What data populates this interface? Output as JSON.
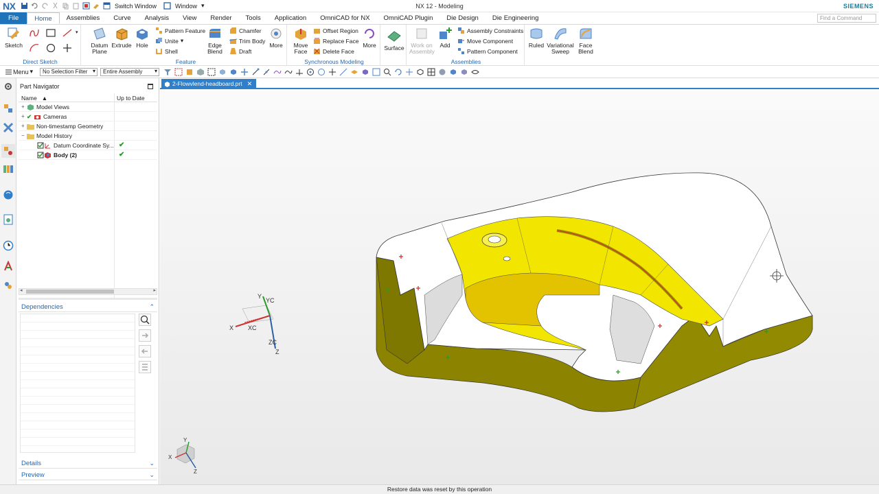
{
  "titlebar": {
    "logo": "NX",
    "switch_window": "Switch Window",
    "window": "Window",
    "title": "NX 12 - Modeling",
    "brand": "SIEMENS"
  },
  "tabs": [
    "File",
    "Home",
    "Assemblies",
    "Curve",
    "Analysis",
    "View",
    "Render",
    "Tools",
    "Application",
    "OmniCAD for NX",
    "OmniCAD Plugin",
    "Die Design",
    "Die Engineering"
  ],
  "active_tab": "Home",
  "find_command": {
    "placeholder": "Find a Command"
  },
  "ribbon": {
    "direct_sketch": {
      "label": "Direct Sketch",
      "sketch": "Sketch"
    },
    "feature": {
      "label": "Feature",
      "datum_plane": "Datum Plane",
      "extrude": "Extrude",
      "hole": "Hole",
      "pattern_feature": "Pattern Feature",
      "unite": "Unite",
      "shell": "Shell",
      "edge_blend": "Edge Blend",
      "chamfer": "Chamfer",
      "trim_body": "Trim Body",
      "draft": "Draft",
      "more": "More"
    },
    "sync": {
      "label": "Synchronous Modeling",
      "move_face": "Move Face",
      "offset_region": "Offset Region",
      "replace_face": "Replace Face",
      "delete_face": "Delete Face",
      "more": "More"
    },
    "surface": {
      "label": "Surface"
    },
    "assemblies": {
      "label": "Assemblies",
      "work_on_assembly": "Work on Assembly",
      "add": "Add",
      "assembly_constraints": "Assembly Constraints",
      "move_component": "Move Component",
      "pattern_component": "Pattern Component"
    },
    "surfaces2": {
      "ruled": "Ruled",
      "variational_sweep": "Variational Sweep",
      "face_blend": "Face Blend"
    }
  },
  "selection_bar": {
    "menu": "Menu",
    "filter": "No Selection Filter",
    "scope": "Entire Assembly"
  },
  "navigator": {
    "title": "Part Navigator",
    "col_name": "Name",
    "col_status": "Up to Date",
    "rows": [
      {
        "label": "Model Views"
      },
      {
        "label": "Cameras"
      },
      {
        "label": "Non-timestamp Geometry"
      },
      {
        "label": "Model History"
      },
      {
        "label": "Datum Coordinate Sy..."
      },
      {
        "label": "Body (2)"
      }
    ],
    "dependencies": "Dependencies",
    "details": "Details",
    "preview": "Preview"
  },
  "graphics": {
    "tab_name": "2-Flowvlend-headboard.prt",
    "axes": {
      "x": "X",
      "y": "Y",
      "z": "Z",
      "xc": "XC",
      "yc": "YC",
      "zc": "ZC"
    }
  },
  "status": {
    "message": "Restore data was reset by this operation"
  },
  "colors": {
    "accent": "#1f74b9",
    "model_yellow": "#f2e600",
    "model_olive": "#8a8400"
  }
}
